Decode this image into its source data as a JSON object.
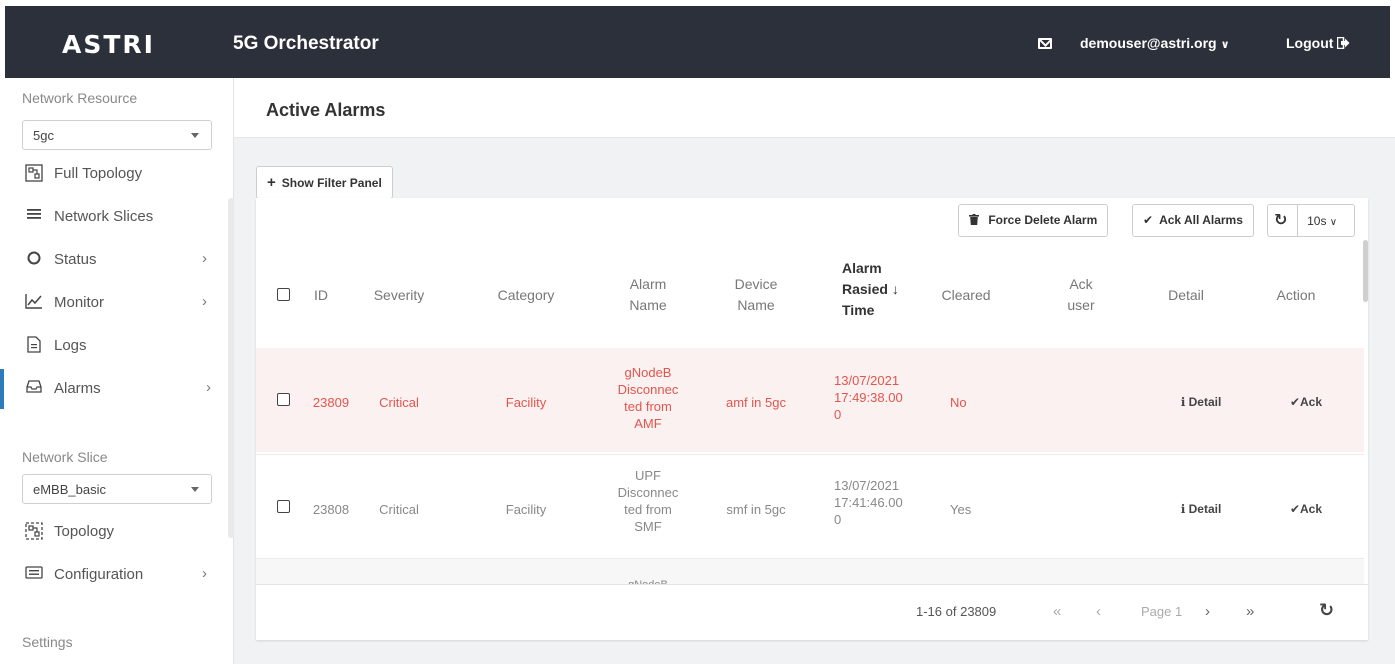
{
  "header": {
    "logo": "ASTRI",
    "app_title": "5G Orchestrator",
    "user": "demouser@astri.org",
    "logout": "Logout"
  },
  "sidebar": {
    "network_resource_label": "Network Resource",
    "network_resource_value": "5gc",
    "items_top": [
      {
        "label": "Full Topology",
        "icon": "topology-icon"
      },
      {
        "label": "Network Slices",
        "icon": "list-icon"
      },
      {
        "label": "Status",
        "icon": "circle-icon"
      },
      {
        "label": "Monitor",
        "icon": "chart-icon"
      },
      {
        "label": "Logs",
        "icon": "document-icon"
      },
      {
        "label": "Alarms",
        "icon": "alarm-icon"
      }
    ],
    "network_slice_label": "Network Slice",
    "network_slice_value": "eMBB_basic",
    "items_bottom": [
      {
        "label": "Topology",
        "icon": "topology-icon"
      },
      {
        "label": "Configuration",
        "icon": "keyboard-icon"
      }
    ],
    "settings_label": "Settings"
  },
  "main": {
    "page_title": "Active Alarms",
    "show_filter_label": "Show Filter Panel",
    "force_delete_label": "Force Delete Alarm",
    "ack_all_label": "Ack All Alarms",
    "refresh_interval": "10s"
  },
  "table": {
    "headers": {
      "id": "ID",
      "severity": "Severity",
      "category": "Category",
      "alarm_name_1": "Alarm",
      "alarm_name_2": "Name",
      "device_name_1": "Device",
      "device_name_2": "Name",
      "raised_1": "Alarm",
      "raised_2": "Rasied",
      "raised_3": "Time",
      "cleared": "Cleared",
      "ack_user_1": "Ack",
      "ack_user_2": "user",
      "detail": "Detail",
      "action": "Action"
    },
    "rows": [
      {
        "id": "23809",
        "severity": "Critical",
        "category": "Facility",
        "alarm_name": [
          "gNodeB",
          "Disconnec",
          "ted from",
          "AMF"
        ],
        "device_name": "amf in 5gc",
        "raised": [
          "13/07/2021",
          "17:49:38.00",
          "0"
        ],
        "cleared": "No",
        "detail": "Detail",
        "action": "Ack"
      },
      {
        "id": "23808",
        "severity": "Critical",
        "category": "Facility",
        "alarm_name": [
          "UPF",
          "Disconnec",
          "ted from",
          "SMF"
        ],
        "device_name": "smf in 5gc",
        "raised": [
          "13/07/2021",
          "17:41:46.00",
          "0"
        ],
        "cleared": "Yes",
        "detail": "Detail",
        "action": "Ack"
      },
      {
        "alarm_name_partial": "gNodeB"
      }
    ]
  },
  "pagination": {
    "range": "1-16 of 23809",
    "page": "Page 1"
  },
  "colors": {
    "header_bg": "#2c303a",
    "critical_text": "#e2554d",
    "critical_row_bg": "#fbf1f1",
    "active_indicator": "#2b7bbd"
  }
}
